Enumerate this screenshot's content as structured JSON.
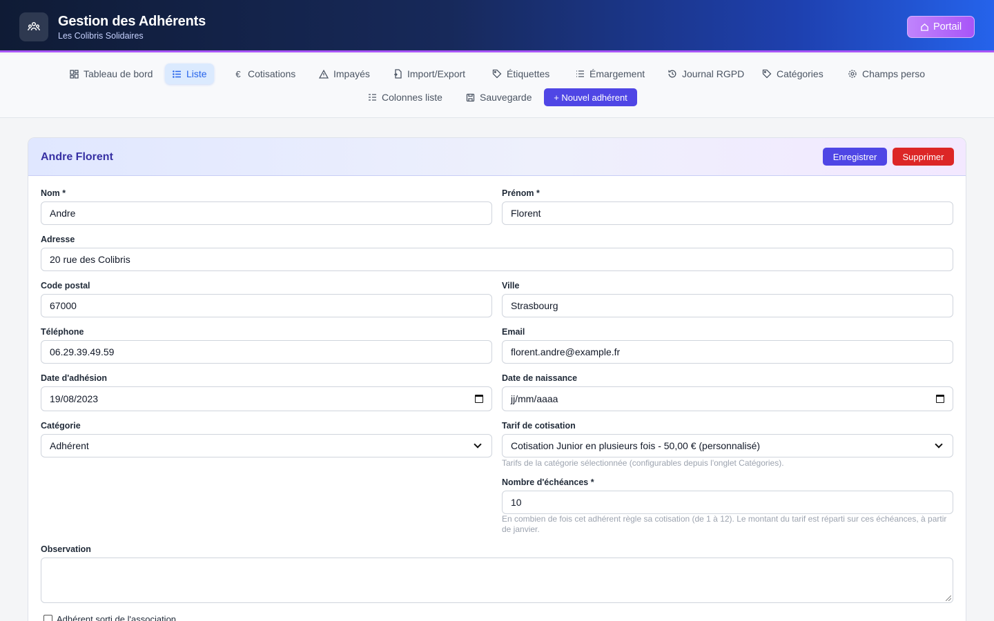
{
  "header": {
    "title": "Gestion des Adhérents",
    "subtitle": "Les Colibris Solidaires",
    "portal_label": "Portail"
  },
  "nav": {
    "items": [
      {
        "label": "Tableau de bord",
        "icon": "dashboard-icon"
      },
      {
        "label": "Liste",
        "icon": "list-icon",
        "active": true
      },
      {
        "label": "Cotisations",
        "icon": "euro-icon"
      },
      {
        "label": "Impayés",
        "icon": "warning-icon"
      },
      {
        "label": "Import/Export",
        "icon": "file-transfer-icon"
      },
      {
        "label": "Étiquettes",
        "icon": "tag-icon"
      },
      {
        "label": "Émargement",
        "icon": "list-lines-icon"
      },
      {
        "label": "Journal RGPD",
        "icon": "history-icon"
      },
      {
        "label": "Catégories",
        "icon": "tag-icon"
      },
      {
        "label": "Champs perso",
        "icon": "gear-icon"
      },
      {
        "label": "Colonnes liste",
        "icon": "columns-icon"
      },
      {
        "label": "Sauvegarde",
        "icon": "save-icon"
      }
    ],
    "new_member_label": "+ Nouvel adhérent"
  },
  "member": {
    "name": "Andre Florent",
    "save_label": "Enregistrer",
    "delete_label": "Supprimer",
    "fields": {
      "nom_label": "Nom *",
      "nom": "Andre",
      "prenom_label": "Prénom *",
      "prenom": "Florent",
      "adresse_label": "Adresse",
      "adresse": "20 rue des Colibris",
      "cp_label": "Code postal",
      "cp": "67000",
      "ville_label": "Ville",
      "ville": "Strasbourg",
      "tel_label": "Téléphone",
      "tel": "06.29.39.49.59",
      "email_label": "Email",
      "email": "florent.andre@example.fr",
      "adhesion_label": "Date d'adhésion",
      "adhesion": "19/08/2023",
      "naissance_label": "Date de naissance",
      "naissance": "jj/mm/aaaa",
      "categorie_label": "Catégorie",
      "categorie": "Adhérent",
      "tarif_label": "Tarif de cotisation",
      "tarif": "Cotisation Junior en plusieurs fois - 50,00 € (personnalisé)",
      "tarif_help": "Tarifs de la catégorie sélectionnée (configurables depuis l'onglet Catégories).",
      "echeances_label": "Nombre d'échéances *",
      "echeances": "10",
      "echeances_help": "En combien de fois cet adhérent règle sa cotisation (de 1 à 12). Le montant du tarif est réparti sur ces échéances, à partir de janvier.",
      "observation_label": "Observation",
      "sorti_label": "Adhérent sorti de l'association"
    }
  }
}
